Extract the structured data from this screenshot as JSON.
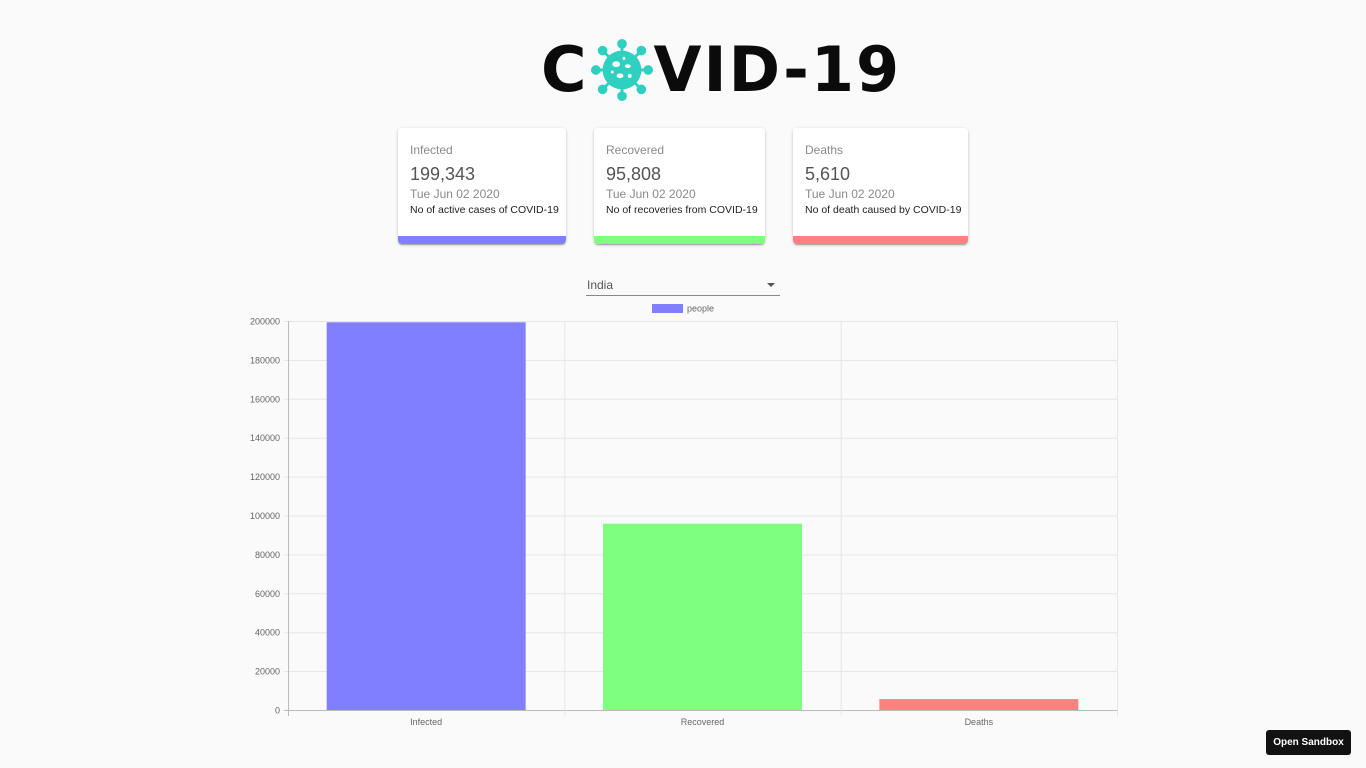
{
  "logo": {
    "text_left": "C",
    "text_right": "VID-19",
    "icon": "virus-icon",
    "accent": "#2fd0c0"
  },
  "cards": [
    {
      "title": "Infected",
      "count": "199,343",
      "date": "Tue Jun 02 2020",
      "desc": "No of active cases of COVID-19",
      "color": "#7f7fff"
    },
    {
      "title": "Recovered",
      "count": "95,808",
      "date": "Tue Jun 02 2020",
      "desc": "No of recoveries from COVID-19",
      "color": "#7fff7f"
    },
    {
      "title": "Deaths",
      "count": "5,610",
      "date": "Tue Jun 02 2020",
      "desc": "No of death caused by COVID-19",
      "color": "#ff8080"
    }
  ],
  "country_picker": {
    "selected": "India",
    "icon": "chevron-down-icon"
  },
  "chart_data": {
    "type": "bar",
    "categories": [
      "Infected",
      "Recovered",
      "Deaths"
    ],
    "series": [
      {
        "name": "people",
        "values": [
          199343,
          95808,
          5610
        ]
      }
    ],
    "colors": [
      "#7f7fff",
      "#7fff7f",
      "#ff8080"
    ],
    "legend_color": "#7f7fff",
    "ylim": [
      0,
      200000
    ],
    "yticks": [
      0,
      20000,
      40000,
      60000,
      80000,
      100000,
      120000,
      140000,
      160000,
      180000,
      200000
    ],
    "grid": true,
    "legend": "top"
  },
  "open_sandbox": {
    "label": "Open Sandbox"
  }
}
